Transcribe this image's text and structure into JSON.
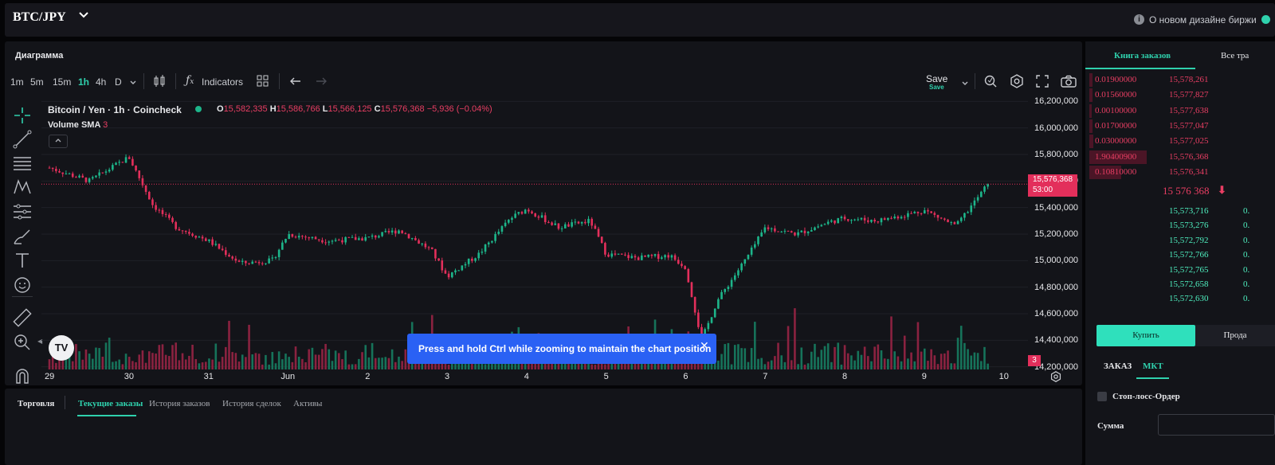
{
  "header": {
    "pair": "BTC/JPY",
    "info_text": "О новом дизайне биржи"
  },
  "chart_panel": {
    "title": "Диаграмма",
    "timeframes": [
      "1m",
      "5m",
      "15m",
      "1h",
      "4h",
      "D"
    ],
    "active_timeframe": "1h",
    "indicators_label": "Indicators",
    "save_label": "Save",
    "save_sub": "Save",
    "legend": {
      "symbol": "Bitcoin / Yen · 1h · Coincheck",
      "o_label": "O",
      "o": "15,582,335",
      "h_label": "H",
      "h": "15,586,766",
      "l_label": "L",
      "l": "15,566,125",
      "c_label": "C",
      "c": "15,576,368",
      "change": "−5,936 (−0.04%)",
      "volume_label": "Volume SMA",
      "volume_value": "3"
    },
    "price_badge": {
      "price": "15,576,368",
      "countdown": "53:00"
    },
    "volume_badge": "3",
    "toast": "Press and hold Ctrl while zooming to maintain the chart position",
    "logo": "TV"
  },
  "chart_data": {
    "type": "candlestick",
    "title": "Bitcoin / Yen · 1h · Coincheck",
    "x_ticks": [
      "29",
      "30",
      "31",
      "Jun",
      "2",
      "3",
      "4",
      "5",
      "6",
      "7",
      "8",
      "9",
      "10"
    ],
    "y_ticks": [
      "16,200,000",
      "16,000,000",
      "15,800,000",
      "15,600,000",
      "15,400,000",
      "15,200,000",
      "15,000,000",
      "14,800,000",
      "14,600,000",
      "14,400,000",
      "14,200,000"
    ],
    "ylim": [
      14180000,
      16220000
    ],
    "last_price": 15576368,
    "close_path": [
      [
        "29",
        15700000
      ],
      [
        "29.5",
        15600000
      ],
      [
        "30",
        15780000
      ],
      [
        "30.3",
        15420000
      ],
      [
        "30.6",
        15250000
      ],
      [
        "31",
        15150000
      ],
      [
        "31.4",
        14980000
      ],
      [
        "31.8",
        15000000
      ],
      [
        "Jun",
        15200000
      ],
      [
        "Jun.5",
        15150000
      ],
      [
        "2",
        15170000
      ],
      [
        "2.4",
        15230000
      ],
      [
        "2.8",
        15080000
      ],
      [
        "3",
        14880000
      ],
      [
        "3.4",
        15050000
      ],
      [
        "3.8",
        15320000
      ],
      [
        "4",
        15390000
      ],
      [
        "4.4",
        15250000
      ],
      [
        "4.8",
        15300000
      ],
      [
        "5",
        15050000
      ],
      [
        "5.4",
        15020000
      ],
      [
        "5.8",
        15040000
      ],
      [
        "6",
        14950000
      ],
      [
        "6.2",
        14400000
      ],
      [
        "6.4",
        14700000
      ],
      [
        "6.8",
        15050000
      ],
      [
        "7",
        15250000
      ],
      [
        "7.4",
        15200000
      ],
      [
        "7.8",
        15290000
      ],
      [
        "8",
        15320000
      ],
      [
        "8.4",
        15300000
      ],
      [
        "8.8",
        15350000
      ],
      [
        "9",
        15380000
      ],
      [
        "9.4",
        15260000
      ],
      [
        "9.8",
        15576368
      ]
    ],
    "volume_badge": 3
  },
  "bottom_tabs": [
    "Торговля",
    "Текущие заказы",
    "История заказов",
    "История сделок",
    "Активы"
  ],
  "order_book": {
    "tab_active": "Книга заказов",
    "tab_other": "Все тра",
    "asks": [
      {
        "qty": "0.01900000",
        "price": "15,578,261",
        "depth": 0.05
      },
      {
        "qty": "0.01560000",
        "price": "15,577,827",
        "depth": 0.05
      },
      {
        "qty": "0.00100000",
        "price": "15,577,638",
        "depth": 0.03
      },
      {
        "qty": "0.01700000",
        "price": "15,577,047",
        "depth": 0.05
      },
      {
        "qty": "0.03000000",
        "price": "15,577,025",
        "depth": 0.06
      },
      {
        "qty": "1.90400900",
        "price": "15,576,368",
        "depth": 0.82
      },
      {
        "qty": "0.10810000",
        "price": "15,576,341",
        "depth": 0.45
      }
    ],
    "mid_price": "15 576 368",
    "bids": [
      {
        "price": "15,573,716",
        "qty": "0."
      },
      {
        "price": "15,573,276",
        "qty": "0."
      },
      {
        "price": "15,572,792",
        "qty": "0."
      },
      {
        "price": "15,572,766",
        "qty": "0."
      },
      {
        "price": "15,572,765",
        "qty": "0."
      },
      {
        "price": "15,572,658",
        "qty": "0."
      },
      {
        "price": "15,572,630",
        "qty": "0."
      }
    ]
  },
  "order_form": {
    "buy_label": "Купить",
    "sell_label": "Прода",
    "tab_order": "ЗАКАЗ",
    "tab_mkt": "МКТ",
    "stop_loss_label": "Стоп-лосс-Ордер",
    "amount_label": "Сумма"
  },
  "colors": {
    "accent": "#2fd1ad",
    "down": "#e93e63",
    "up": "#1db58a",
    "toast": "#2a61f4"
  }
}
